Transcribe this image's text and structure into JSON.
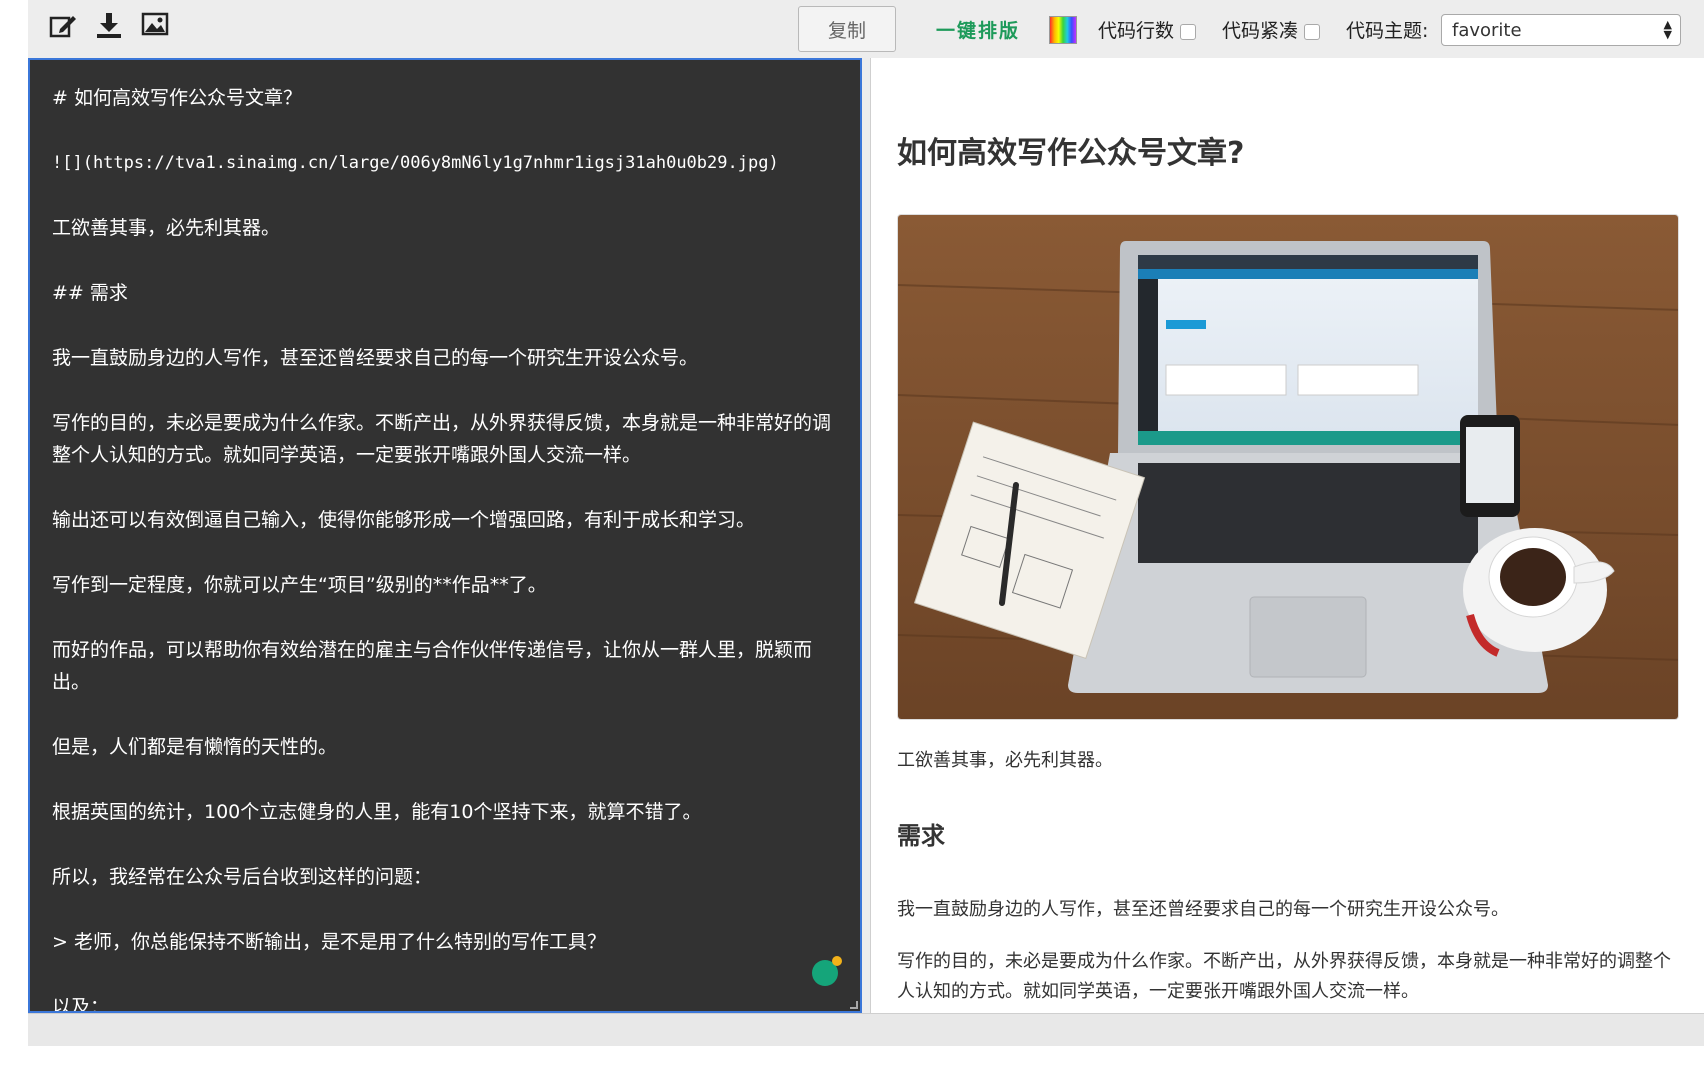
{
  "toolbar": {
    "icons": [
      "edit-icon",
      "download-icon",
      "image-icon"
    ],
    "copy_label": "复制",
    "format_label": "一键排版",
    "line_numbers_label": "代码行数",
    "compact_label": "代码紧凑",
    "theme_label": "代码主题:",
    "theme_value": "favorite"
  },
  "editor": {
    "lines": [
      "# 如何高效写作公众号文章？",
      "![](https://tva1.sinaimg.cn/large/006y8mN6ly1g7nhmr1igsj31ah0u0b29.jpg)",
      "工欲善其事，必先利其器。",
      "## 需求",
      "我一直鼓励身边的人写作，甚至还曾经要求自己的每一个研究生开设公众号。",
      "写作的目的，未必是要成为什么作家。不断产出，从外界获得反馈，本身就是一种非常好的调整个人认知的方式。就如同学英语，一定要张开嘴跟外国人交流一样。",
      "输出还可以有效倒逼自己输入，使得你能够形成一个增强回路，有利于成长和学习。",
      "写作到一定程度，你就可以产生“项目”级别的**作品**了。",
      "而好的作品，可以帮助你有效给潜在的雇主与合作伙伴传递信号，让你从一群人里，脱颖而出。",
      "但是，人们都是有懒惰的天性的。",
      "根据英国的统计，100个立志健身的人里，能有10个坚持下来，就算不错了。",
      "所以，我经常在公众号后台收到这样的问题：",
      "> 老师，你总能保持不断输出，是不是用了什么特别的写作工具？",
      "以及："
    ]
  },
  "preview": {
    "title": "如何高效写作公众号文章?",
    "p1": "工欲善其事，必先利其器。",
    "h2": "需求",
    "p2": "我一直鼓励身边的人写作，甚至还曾经要求自己的每一个研究生开设公众号。",
    "p3": "写作的目的，未必是要成为什么作家。不断产出，从外界获得反馈，本身就是一种非常好的调整个人认知的方式。就如同学英语，一定要张开嘴跟外国人交流一样。"
  },
  "colors": {
    "editor_bg": "#323232",
    "editor_border": "#3b77d9",
    "format_green": "#1d9a5a"
  }
}
